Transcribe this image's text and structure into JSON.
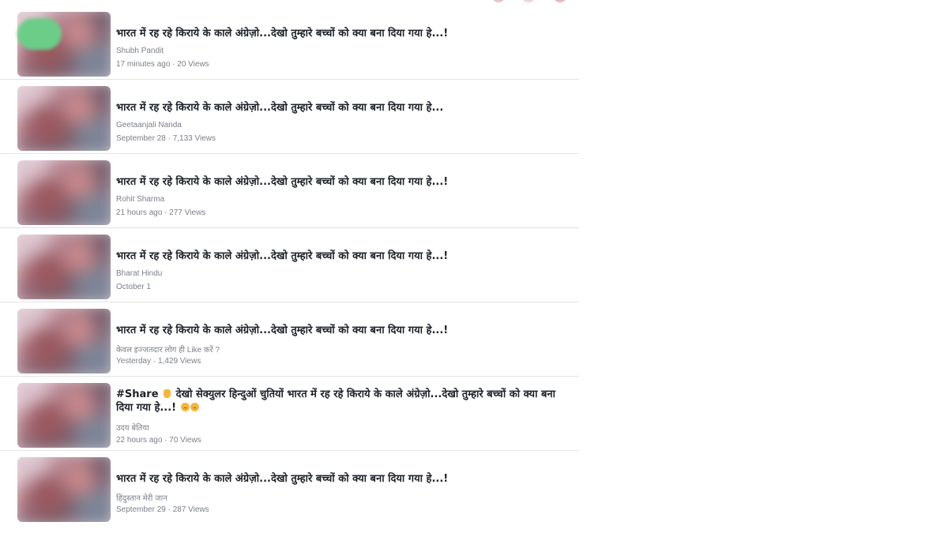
{
  "feed": {
    "items": [
      {
        "title": "भारत में रह रहे किराये के काले अंग्रेज़ो...देखो तुम्हारे बच्चों को क्या बना दिया गया हे...!",
        "author": "Shubh Pandit",
        "meta": "17 minutes ago · 20 Views"
      },
      {
        "title": "भारत में रह रहे किराये के काले अंग्रेज़ो...देखो तुम्हारे बच्चों को क्या बना दिया गया हे...",
        "author": "Geetaanjali Nanda",
        "meta": "September 28 · 7,133 Views"
      },
      {
        "title": "भारत में रह रहे किराये के काले अंग्रेज़ो...देखो तुम्हारे बच्चों को क्या बना दिया गया हे...!",
        "author": "Rohit Sharma",
        "meta": "21 hours ago · 277 Views"
      },
      {
        "title": "भारत में रह रहे किराये के काले अंग्रेज़ो...देखो तुम्हारे बच्चों को क्या बना दिया गया हे...!",
        "author": "Bharat Hindu",
        "meta": "October 1"
      },
      {
        "title": "भारत में रह रहे किराये के काले अंग्रेज़ो...देखो तुम्हारे बच्चों को क्या बना दिया गया हे...!",
        "author": "केवल इज्जतदार लोग ही Like करें ?",
        "meta": "Yesterday · 1,429 Views"
      },
      {
        "share_tag": "#Share",
        "title": "देखो सेक्युलर हिन्दुओं चुतियों भारत में रह रहे किराये के काले अंग्रेज़ो...देखो तुम्हारे बच्चों को क्या बना दिया गया हे...!",
        "author": "उदय बेतिया",
        "meta": "22 hours ago · 70 Views"
      },
      {
        "title": "भारत में रह रहे किराये के काले अंग्रेज़ो...देखो तुम्हारे बच्चों को क्या बना दिया गया हे...!",
        "author": "हिंदुस्तान मेरी जान",
        "meta": "September 29 · 287 Views"
      }
    ]
  },
  "colors": {
    "title_text": "#1d2129",
    "meta_text": "#7a7f88",
    "divider": "#e3e3e3",
    "badge": "#6ccd88"
  }
}
